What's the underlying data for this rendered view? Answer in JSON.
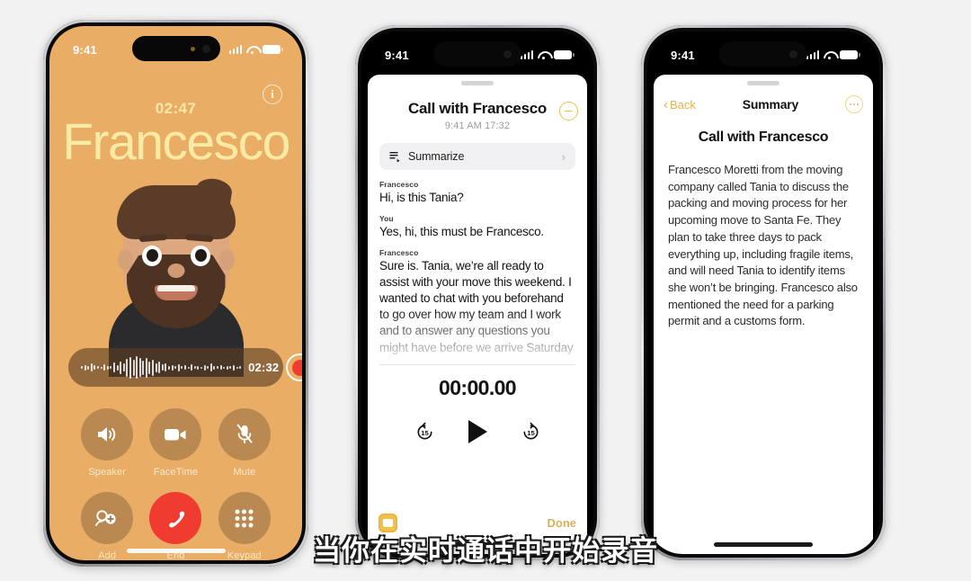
{
  "background_color": "#f2f2f2",
  "subtitle": "当你在实时通话中开始录音",
  "phone1": {
    "status_bar": {
      "time": "9:41",
      "signal_icon": "cellular-bars-icon",
      "wifi_icon": "wifi-icon",
      "battery_icon": "battery-icon"
    },
    "screen_bg_color": "#e9ad66",
    "info_button": "i",
    "call_timer": "02:47",
    "caller_name": "Francesco",
    "avatar": "memoji-avatar",
    "recording": {
      "time": "02:32",
      "record_button": "stop-record-button",
      "waveform": "audio-waveform"
    },
    "controls": [
      {
        "label": "Speaker",
        "icon": "speaker-icon"
      },
      {
        "label": "FaceTime",
        "icon": "video-camera-icon"
      },
      {
        "label": "Mute",
        "icon": "microphone-muted-icon"
      },
      {
        "label": "Add",
        "icon": "add-person-icon"
      },
      {
        "label": "End",
        "icon": "end-call-icon"
      },
      {
        "label": "Keypad",
        "icon": "keypad-icon"
      }
    ]
  },
  "phone2": {
    "status_bar": {
      "time": "9:41"
    },
    "title": "Call with Francesco",
    "subtitle": "9:41 AM  17:32",
    "stop_button": "stop-recording-button",
    "summarize": {
      "label": "Summarize",
      "icon": "summarize-icon",
      "chevron": "›"
    },
    "transcript": [
      {
        "speaker": "Francesco",
        "text": "Hi, is this Tania?"
      },
      {
        "speaker": "You",
        "text": "Yes, hi, this must be Francesco."
      },
      {
        "speaker": "Francesco",
        "text": "Sure is. Tania, we’re all ready to assist with your move this weekend. I wanted to chat with you beforehand to go over how my team and I work and to answer any questions you might have before we arrive Saturday"
      }
    ],
    "player": {
      "time": "00:00.00",
      "back_label": "15",
      "forward_label": "15",
      "play_icon": "play-icon"
    },
    "notes_icon": "notes-app-icon",
    "done_label": "Done"
  },
  "phone3": {
    "status_bar": {
      "time": "9:41"
    },
    "back_label": "Back",
    "nav_title": "Summary",
    "more_button": "more-options-button",
    "title": "Call with Francesco",
    "body": "Francesco Moretti from the moving company called Tania to discuss the packing and moving process for her upcoming move to Santa Fe. They plan to take three days to pack everything up, including fragile items, and will need Tania to identify items she won’t be bringing. Francesco also mentioned the need for a parking permit and a customs form."
  }
}
